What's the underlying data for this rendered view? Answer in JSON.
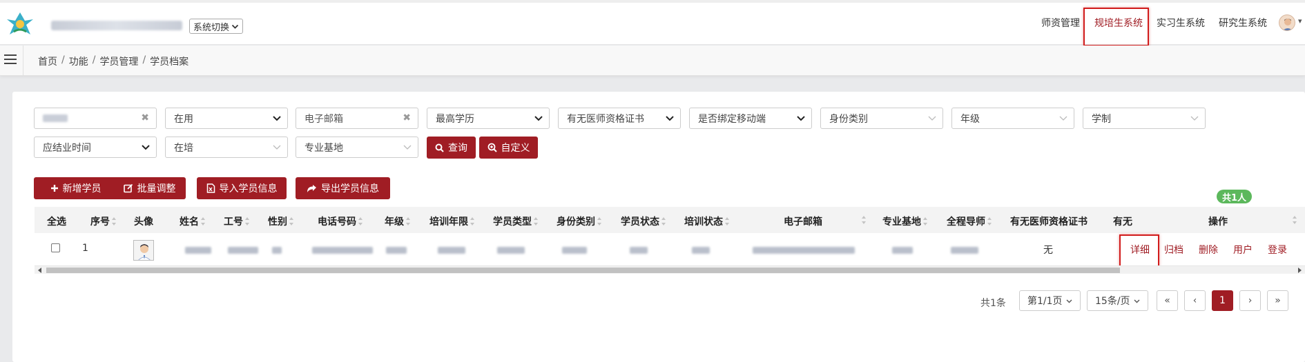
{
  "header": {
    "system_switch": "系统切换",
    "nav": [
      "师资管理",
      "规培生系统",
      "实习生系统",
      "研究生系统"
    ],
    "active_nav_index": 1
  },
  "breadcrumb": [
    "首页",
    "功能",
    "学员管理",
    "学员档案"
  ],
  "filters": {
    "status": "在用",
    "email_placeholder": "电子邮箱",
    "education": "最高学历",
    "doctor_cert": "有无医师资格证书",
    "mobile_bound": "是否绑定移动端",
    "identity_type": "身份类别",
    "grade": "年级",
    "school_system": "学制",
    "graduation_time": "应结业时间",
    "training_status": "在培",
    "base": "专业基地",
    "query_label": "查询",
    "custom_label": "自定义"
  },
  "actions": {
    "add": "新增学员",
    "batch": "批量调整",
    "import": "导入学员信息",
    "export": "导出学员信息"
  },
  "count_badge": "共1人",
  "table": {
    "headers": [
      "全选",
      "序号",
      "头像",
      "姓名",
      "工号",
      "性别",
      "电话号码",
      "年级",
      "培训年限",
      "学员类型",
      "身份类别",
      "学员状态",
      "培训状态",
      "电子邮箱",
      "专业基地",
      "全程导师",
      "有无医师资格证书",
      "有无",
      "操作"
    ],
    "row": {
      "index": "1",
      "doctor_cert": "无",
      "ops": [
        "详细",
        "归档",
        "删除",
        "用户",
        "登录"
      ]
    }
  },
  "pagination": {
    "total": "共1条",
    "page_select": "第1/1页",
    "size_select": "15条/页",
    "first": "«",
    "prev": "‹",
    "current": "1",
    "next": "›",
    "last": "»"
  },
  "colors": {
    "brand": "#a01d24",
    "badge": "#5cb85c",
    "highlight": "#d11b1b"
  }
}
